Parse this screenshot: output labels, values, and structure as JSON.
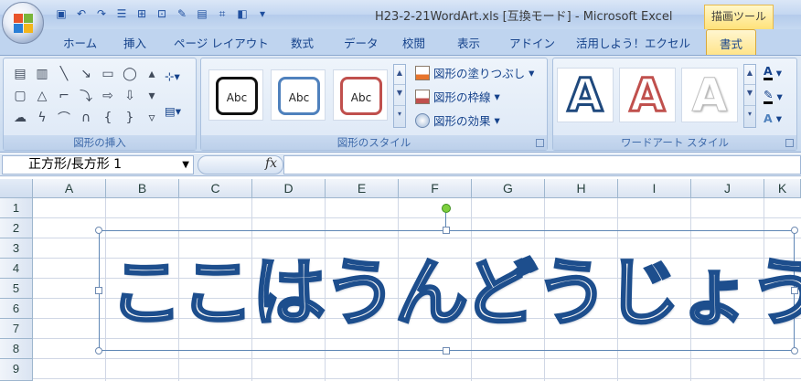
{
  "titlebar": {
    "title": "H23-2-21WordArt.xls [互換モード] - Microsoft Excel",
    "context_tab_header": "描画ツール",
    "qat_icons": [
      "save-icon",
      "undo-icon",
      "redo-icon",
      "align-icon",
      "group-icon",
      "shapes-icon",
      "edit-icon",
      "format-icon",
      "crop-icon",
      "fill-icon",
      "customize-icon"
    ]
  },
  "tabs": {
    "home": "ホーム",
    "insert": "挿入",
    "page_layout": "ページ レイアウト",
    "formulas": "数式",
    "data": "データ",
    "review": "校閲",
    "view": "表示",
    "addins": "アドイン",
    "utilize": "活用しよう！エクセル",
    "format": "書式"
  },
  "ribbon": {
    "insert_shapes": {
      "label": "図形の挿入"
    },
    "shape_styles": {
      "label": "図形のスタイル",
      "sample_text": "Abc",
      "fill": "図形の塗りつぶし",
      "outline": "図形の枠線",
      "effects": "図形の効果"
    },
    "wordart_styles": {
      "label": "ワードアート スタイル",
      "sample_letter": "A"
    }
  },
  "formula_bar": {
    "name_box": "正方形/長方形 1",
    "fx": "fx",
    "formula": ""
  },
  "sheet": {
    "columns": [
      "A",
      "B",
      "C",
      "D",
      "E",
      "F",
      "G",
      "H",
      "I",
      "J",
      "K"
    ],
    "rows": [
      "1",
      "2",
      "3",
      "4",
      "5",
      "6",
      "7",
      "8",
      "9"
    ]
  },
  "wordart": {
    "text": "ここはうんどうじょう",
    "fill_color": "#f5f5f5",
    "outline_color": "#1d4e8d"
  }
}
